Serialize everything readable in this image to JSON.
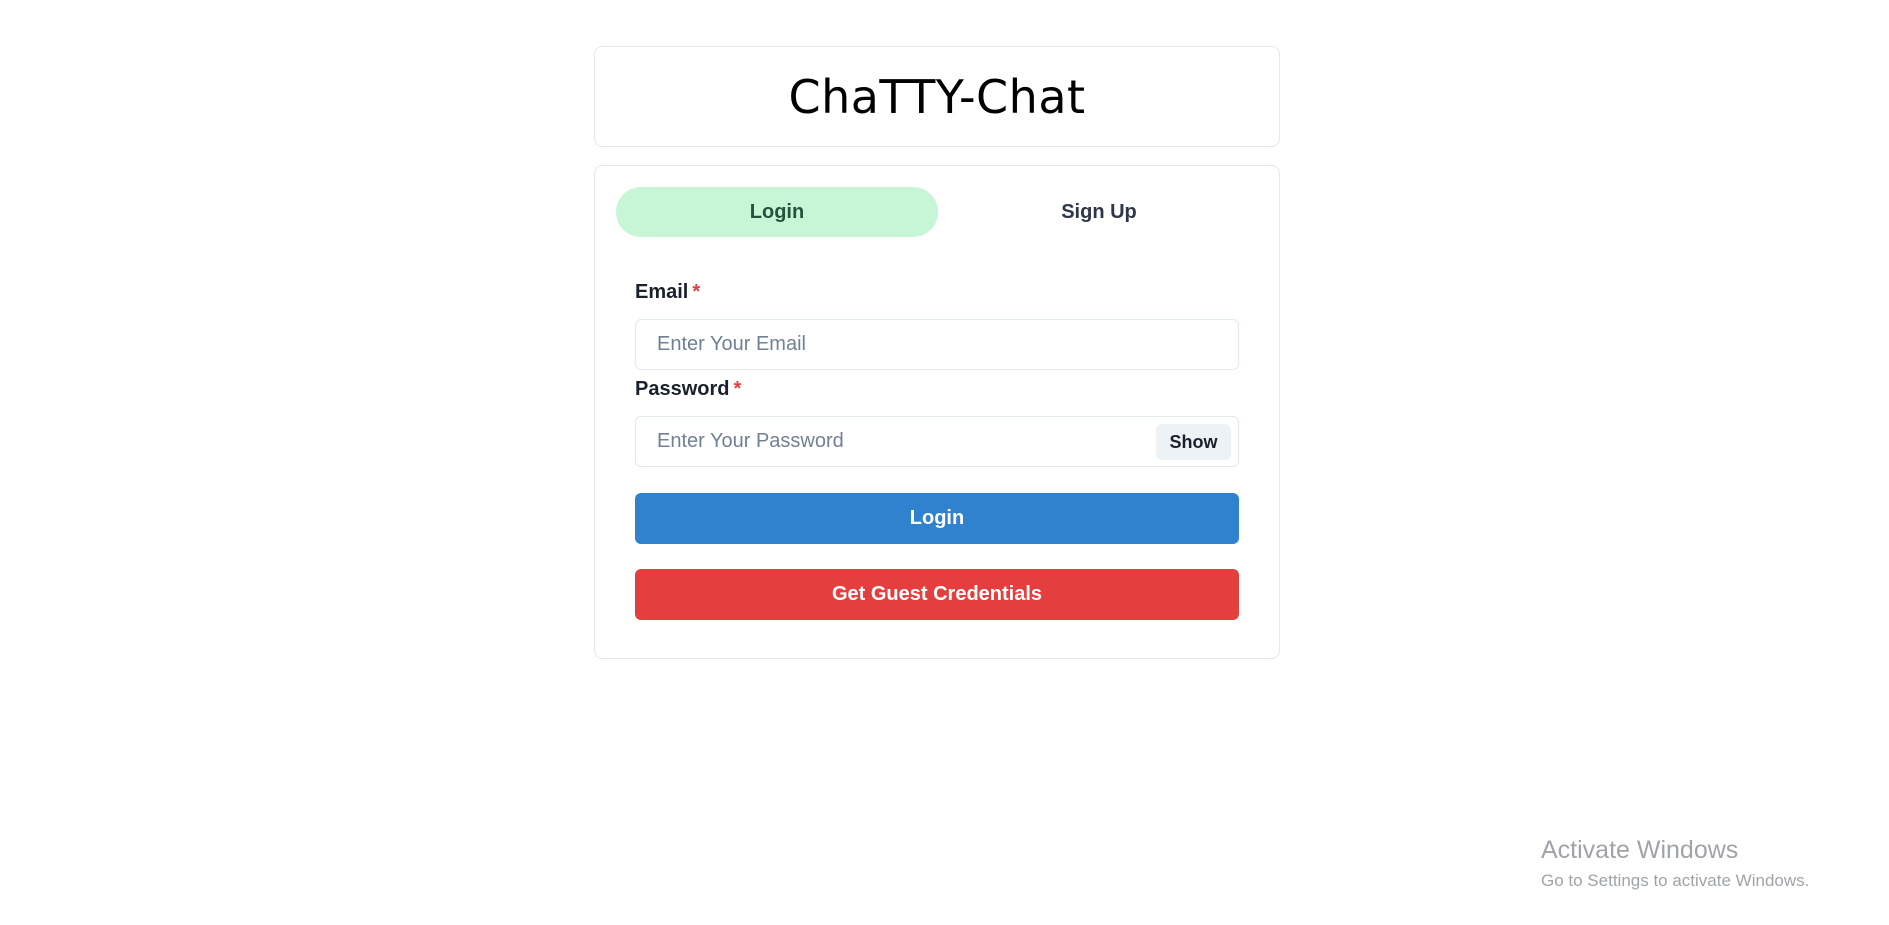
{
  "app": {
    "title": "ChaTTY-Chat"
  },
  "tabs": [
    {
      "label": "Login",
      "active": true
    },
    {
      "label": "Sign Up",
      "active": false
    }
  ],
  "form": {
    "email": {
      "label": "Email",
      "required_mark": "*",
      "placeholder": "Enter Your Email",
      "value": ""
    },
    "password": {
      "label": "Password",
      "required_mark": "*",
      "placeholder": "Enter Your Password",
      "value": "",
      "toggle_label": "Show"
    },
    "login_button": "Login",
    "guest_button": "Get Guest Credentials"
  },
  "colors": {
    "active_tab_bg": "#c6f6d5",
    "primary_button": "#3182ce",
    "danger_button": "#e53e3e",
    "required_mark": "#e53e3e"
  },
  "os_watermark": {
    "title": "Activate Windows",
    "subtitle": "Go to Settings to activate Windows."
  }
}
